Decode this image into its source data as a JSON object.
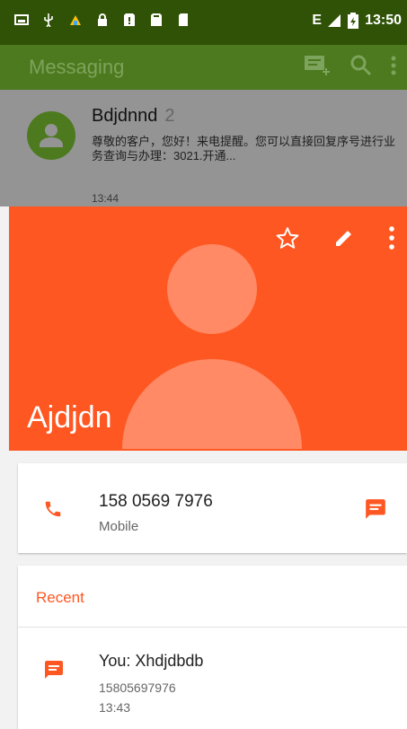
{
  "status_bar": {
    "network": "E",
    "time": "13:50"
  },
  "messaging": {
    "title": "Messaging",
    "conversation": {
      "name": "Bdjdnnd",
      "count": "2",
      "snippet": "尊敬的客户，您好！来电提醒。您可以直接回复序号进行业务查询与办理：3021.开通...",
      "time": "13:44"
    }
  },
  "contact": {
    "name": "Ajdjdn",
    "phone": {
      "number": "158 0569 7976",
      "type": "Mobile"
    },
    "recent": {
      "title": "Recent",
      "message": "You: Xhdjdbdb",
      "number": "15805697976",
      "time": "13:43"
    }
  },
  "colors": {
    "accent": "#ff5722",
    "status_bar": "#2f5206",
    "app_bar": "#4d7a1e"
  }
}
